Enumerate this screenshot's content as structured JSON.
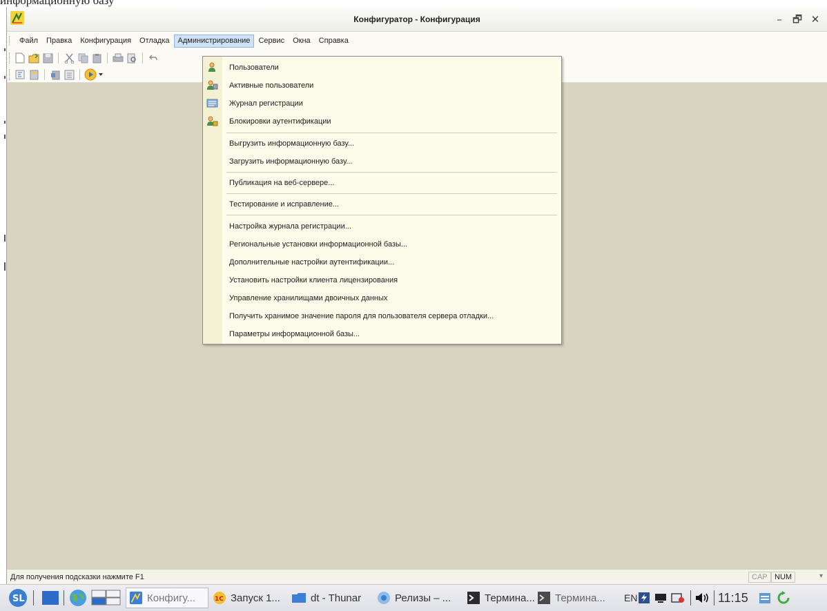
{
  "cropped_caption": "информационную базу",
  "window": {
    "title": "Конфигуратор - Конфигурация",
    "controls": {
      "minimize": "–",
      "maximize": "🗗",
      "close": "✕"
    }
  },
  "menubar": {
    "items": [
      {
        "label": "Файл"
      },
      {
        "label": "Правка"
      },
      {
        "label": "Конфигурация"
      },
      {
        "label": "Отладка"
      },
      {
        "label": "Администрирование"
      },
      {
        "label": "Сервис"
      },
      {
        "label": "Окна"
      },
      {
        "label": "Справка"
      }
    ],
    "active": "Администрирование"
  },
  "toolbar1": {
    "icons": [
      "new-document-icon",
      "open-icon",
      "save-icon",
      "cut-icon",
      "copy-icon",
      "paste-icon",
      "print-icon",
      "print-preview-icon",
      "undo-icon"
    ]
  },
  "toolbar2": {
    "icons": [
      "open-configuration-icon",
      "database-config-icon",
      "update-db-icon",
      "tree-icon",
      "run-debug-icon"
    ]
  },
  "admin_menu": {
    "items": [
      {
        "label": "Пользователи",
        "icon": "user-icon"
      },
      {
        "label": "Активные пользователи",
        "icon": "active-users-icon"
      },
      {
        "label": "Журнал регистрации",
        "icon": "event-log-icon"
      },
      {
        "label": "Блокировки аутентификации",
        "icon": "auth-lock-icon"
      },
      {
        "label": "Выгрузить информационную базу..."
      },
      {
        "label": "Загрузить информационную базу..."
      },
      {
        "label": "Публикация на веб-сервере..."
      },
      {
        "label": "Тестирование и исправление..."
      },
      {
        "label": "Настройка журнала регистрации..."
      },
      {
        "label": "Региональные установки информационной базы..."
      },
      {
        "label": "Дополнительные настройки аутентификации..."
      },
      {
        "label": "Установить настройки клиента лицензирования"
      },
      {
        "label": "Управление хранилищами двоичных данных"
      },
      {
        "label": "Получить хранимое значение пароля для пользователя сервера отладки..."
      },
      {
        "label": "Параметры информационной базы..."
      }
    ]
  },
  "statusbar": {
    "hint": "Для получения подсказки нажмите F1",
    "cap": "CAP",
    "num": "NUM"
  },
  "taskbar": {
    "tasks": [
      {
        "label": "Конфигу...",
        "icon": "1c-config-icon"
      },
      {
        "label": "Запуск 1...",
        "icon": "1c-launch-icon"
      },
      {
        "label": "dt - Thunar",
        "icon": "folder-icon"
      },
      {
        "label": "Релизы – ...",
        "icon": "browser-icon"
      },
      {
        "label": "Термина...",
        "icon": "terminal-icon"
      },
      {
        "label": "Термина...",
        "icon": "terminal-icon"
      }
    ],
    "tray": {
      "lang": "EN",
      "clock": "11:15"
    }
  },
  "colors": {
    "workspace": "#d8d4c0",
    "menu_bg": "#fdfbea",
    "active_menu": "#cfe2f7"
  }
}
